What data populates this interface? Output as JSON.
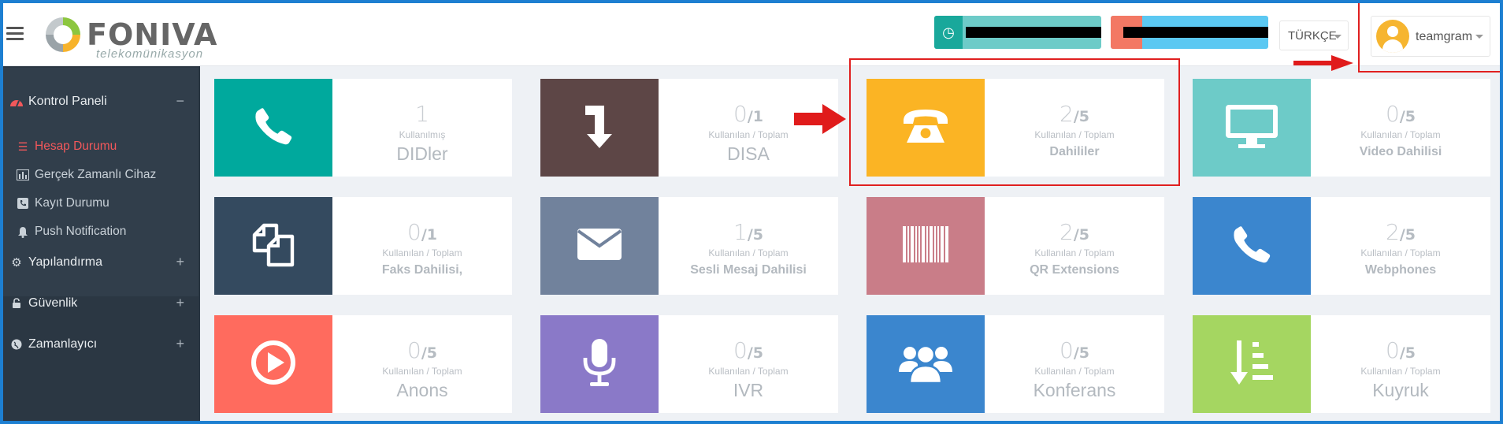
{
  "header": {
    "logo_text": "FONIVA",
    "logo_sub": "telekomünikasyon",
    "language": "TÜRKÇE",
    "username": "teamgram"
  },
  "sidebar": {
    "items": [
      {
        "label": "Kontrol Paneli",
        "indicator": "−",
        "icon": "dashboard-icon"
      },
      {
        "label": "Yapılandırma",
        "indicator": "+",
        "icon": "gears-icon"
      },
      {
        "label": "Güvenlik",
        "indicator": "+",
        "icon": "lock-icon"
      },
      {
        "label": "Zamanlayıcı",
        "indicator": "+",
        "icon": "globe-icon"
      }
    ],
    "subitems": [
      {
        "label": "Hesap Durumu",
        "icon": "list-icon"
      },
      {
        "label": "Gerçek Zamanlı Cihaz",
        "icon": "bar-chart-icon"
      },
      {
        "label": "Kayıt Durumu",
        "icon": "phone-square-icon"
      },
      {
        "label": "Push Notification",
        "icon": "bell-icon"
      }
    ]
  },
  "tiles": [
    {
      "used": "1",
      "total": "",
      "sublabel": "Kullanılmış",
      "label": "DIDler",
      "bold": false,
      "icon": "phone-icon",
      "color": "#00a99d"
    },
    {
      "used": "0",
      "total": "1",
      "sublabel": "Kullanılan / Toplam",
      "label": "DISA",
      "bold": false,
      "icon": "arrow-turn-down-icon",
      "color": "#5d4646"
    },
    {
      "used": "2",
      "total": "5",
      "sublabel": "Kullanılan / Toplam",
      "label": "Dahililer",
      "bold": true,
      "icon": "desk-phone-icon",
      "color": "#fbb424"
    },
    {
      "used": "0",
      "total": "5",
      "sublabel": "Kullanılan / Toplam",
      "label": "Video Dahilisi",
      "bold": true,
      "icon": "monitor-icon",
      "color": "#6dcbc8"
    },
    {
      "used": "0",
      "total": "1",
      "sublabel": "Kullanılan / Toplam",
      "label": "Faks Dahilisi,",
      "bold": true,
      "icon": "copy-icon",
      "color": "#344a5f"
    },
    {
      "used": "1",
      "total": "5",
      "sublabel": "Kullanılan / Toplam",
      "label": "Sesli Mesaj Dahilisi",
      "bold": true,
      "icon": "envelope-icon",
      "color": "#71829c"
    },
    {
      "used": "2",
      "total": "5",
      "sublabel": "Kullanılan / Toplam",
      "label": "QR Extensions",
      "bold": true,
      "icon": "barcode-icon",
      "color": "#c97d88"
    },
    {
      "used": "2",
      "total": "5",
      "sublabel": "Kullanılan / Toplam",
      "label": "Webphones",
      "bold": true,
      "icon": "phone-icon",
      "color": "#3b86ce"
    },
    {
      "used": "0",
      "total": "5",
      "sublabel": "Kullanılan / Toplam",
      "label": "Anons",
      "bold": false,
      "icon": "play-circle-icon",
      "color": "#ff6b5e"
    },
    {
      "used": "0",
      "total": "5",
      "sublabel": "Kullanılan / Toplam",
      "label": "IVR",
      "bold": false,
      "icon": "microphone-icon",
      "color": "#8a79c8"
    },
    {
      "used": "0",
      "total": "5",
      "sublabel": "Kullanılan / Toplam",
      "label": "Konferans",
      "bold": false,
      "icon": "users-icon",
      "color": "#3b86ce"
    },
    {
      "used": "0",
      "total": "5",
      "sublabel": "Kullanılan / Toplam",
      "label": "Kuyruk",
      "bold": false,
      "icon": "sort-list-icon",
      "color": "#a5d661"
    }
  ]
}
